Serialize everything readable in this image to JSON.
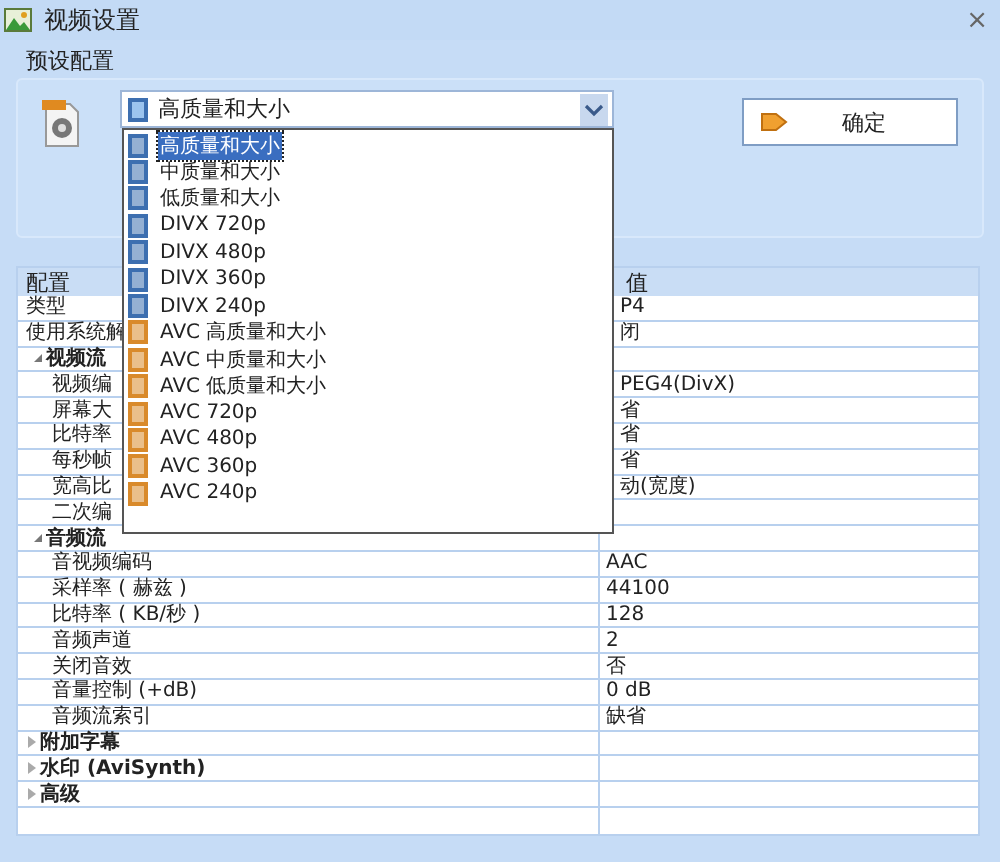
{
  "window": {
    "title": "视频设置",
    "close": "×"
  },
  "preset": {
    "label": "预设配置",
    "combo_value": "高质量和大小",
    "ok_button": "确定",
    "options": [
      {
        "label": "高质量和大小",
        "selected": true,
        "color": "#3d6fb0"
      },
      {
        "label": "中质量和大小",
        "selected": false,
        "color": "#3d6fb0"
      },
      {
        "label": "低质量和大小",
        "selected": false,
        "color": "#3d6fb0"
      },
      {
        "label": "DIVX 720p",
        "selected": false,
        "color": "#3d6fb0"
      },
      {
        "label": "DIVX 480p",
        "selected": false,
        "color": "#3d6fb0"
      },
      {
        "label": "DIVX 360p",
        "selected": false,
        "color": "#3d6fb0"
      },
      {
        "label": "DIVX 240p",
        "selected": false,
        "color": "#3d6fb0"
      },
      {
        "label": "AVC 高质量和大小",
        "selected": false,
        "color": "#d98a2b"
      },
      {
        "label": "AVC 中质量和大小",
        "selected": false,
        "color": "#d98a2b"
      },
      {
        "label": "AVC 低质量和大小",
        "selected": false,
        "color": "#d98a2b"
      },
      {
        "label": "AVC 720p",
        "selected": false,
        "color": "#d98a2b"
      },
      {
        "label": "AVC 480p",
        "selected": false,
        "color": "#d98a2b"
      },
      {
        "label": "AVC 360p",
        "selected": false,
        "color": "#d98a2b"
      },
      {
        "label": "AVC 240p",
        "selected": false,
        "color": "#d98a2b"
      }
    ]
  },
  "table": {
    "columns": [
      "配置",
      "值"
    ],
    "rows": [
      {
        "name": "类型",
        "value": "P4"
      },
      {
        "name": "使用系统解",
        "value": "闭"
      },
      {
        "name": "视频流",
        "expanded": true,
        "children": [
          {
            "name": "视频编",
            "value": "PEG4(DivX)"
          },
          {
            "name": "屏幕大",
            "value": "省"
          },
          {
            "name": "比特率",
            "value": "省"
          },
          {
            "name": "每秒帧",
            "value": "省"
          },
          {
            "name": "宽高比",
            "value": "动(宽度)"
          },
          {
            "name": "二次编"
          }
        ]
      },
      {
        "name": "音频流",
        "expanded": true,
        "children": [
          {
            "name": "音视频编码",
            "value": "AAC"
          },
          {
            "name": "采样率 ( 赫兹 )",
            "value": "44100"
          },
          {
            "name": "比特率 ( KB/秒 )",
            "value": "128"
          },
          {
            "name": "音频声道",
            "value": "2"
          },
          {
            "name": "关闭音效",
            "value": "否"
          },
          {
            "name": "音量控制 (+dB)",
            "value": "0 dB"
          },
          {
            "name": "音频流索引",
            "value": "缺省"
          }
        ]
      },
      {
        "name": "附加字幕",
        "expanded": false
      },
      {
        "name": "水印 (AviSynth)",
        "expanded": false
      },
      {
        "name": "高级",
        "expanded": false
      }
    ]
  }
}
